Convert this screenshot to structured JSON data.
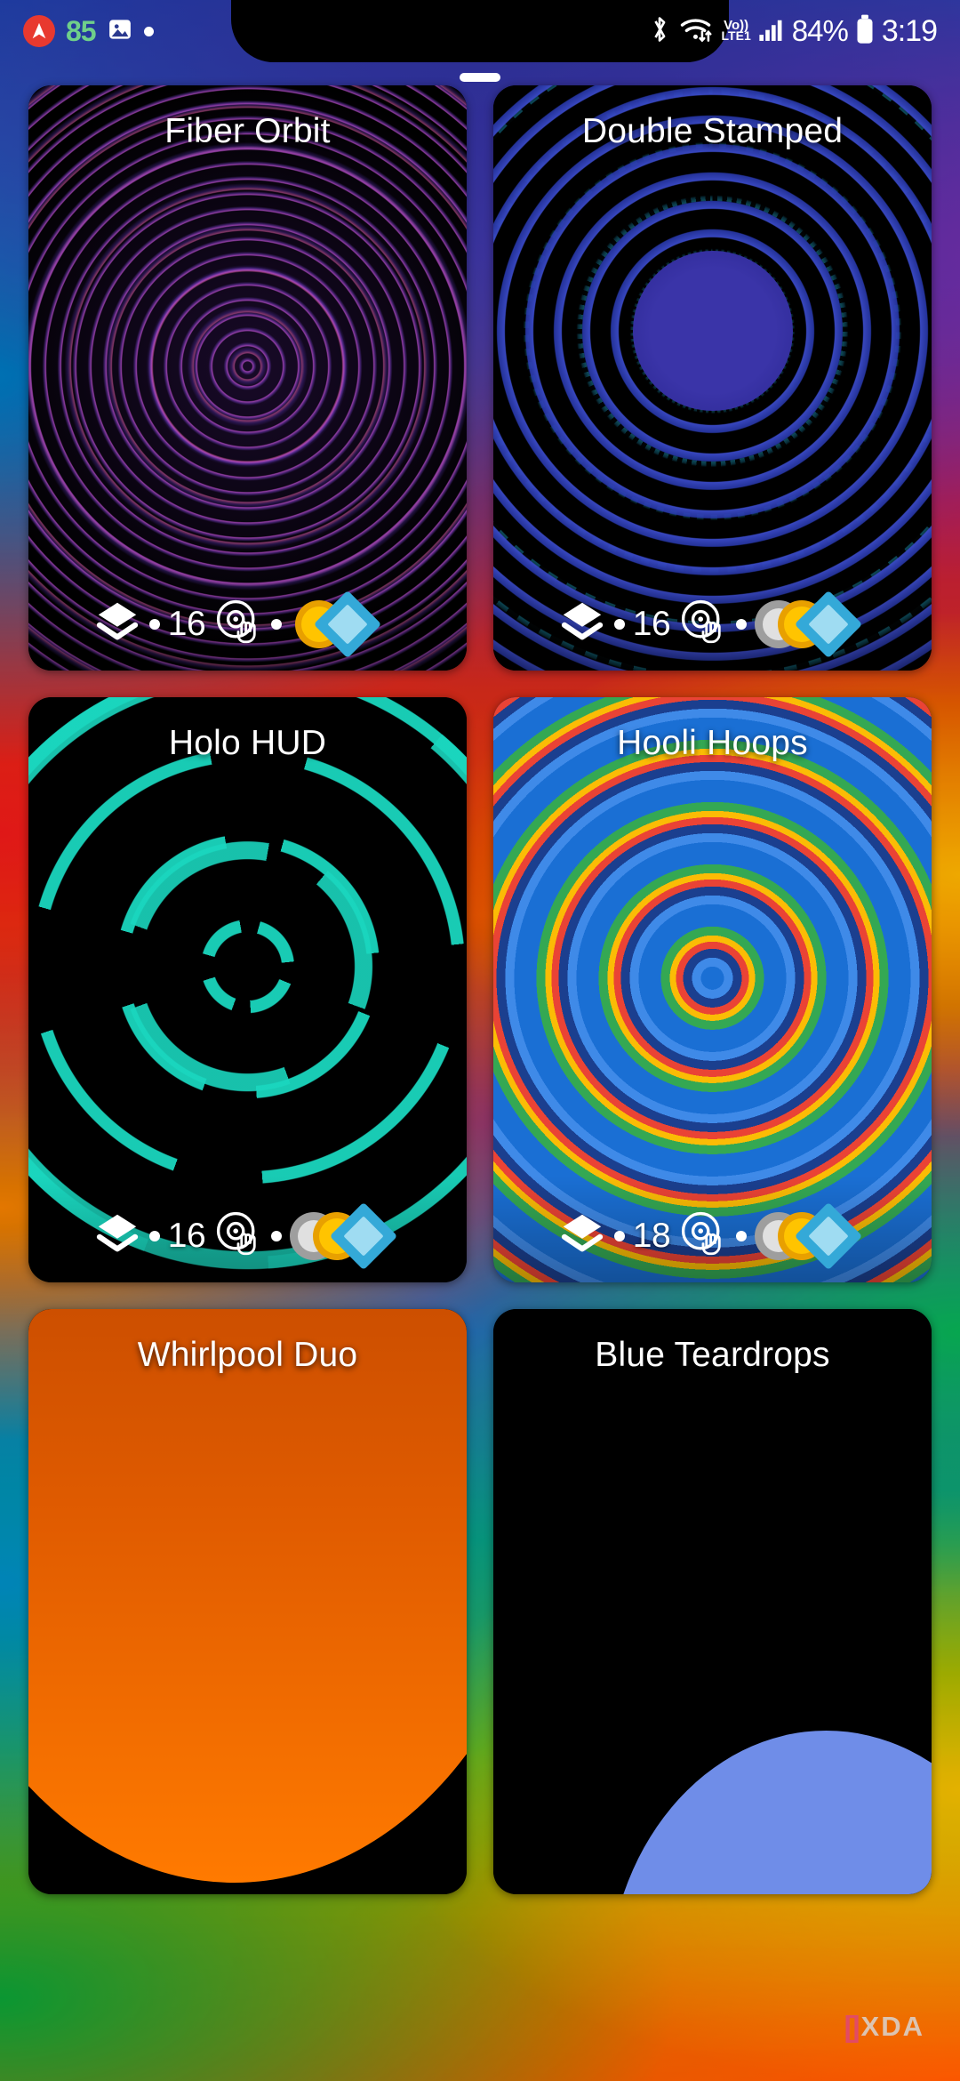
{
  "status_bar": {
    "left": {
      "nav_icon": "navigation-arrow-icon",
      "step_count": "85",
      "photo_icon": "image-icon",
      "extra_dot": "dot-indicator"
    },
    "right": {
      "bluetooth_icon": "bluetooth-icon",
      "wifi_icon": "wifi-data-transfer-icon",
      "volte_top": "Vo))",
      "volte_bottom": "LTE1",
      "signal_icon": "cellular-signal-icon",
      "battery_percent": "84%",
      "battery_icon": "battery-icon",
      "time": "3:19"
    }
  },
  "gesture_pill": "home-gesture-pill",
  "watermark": {
    "bracket": "[]",
    "text": "XDA"
  },
  "grid": {
    "cards": [
      {
        "title": "Fiber Orbit",
        "layers_icon": "layers-icon",
        "separator": "•",
        "count": "16",
        "disc_icon": "disc-tap-icon",
        "dot": "•",
        "shape_count": 2,
        "art": "art-fiber",
        "accent": "#b450d2"
      },
      {
        "title": "Double Stamped",
        "layers_icon": "layers-icon",
        "separator": "•",
        "count": "16",
        "disc_icon": "disc-tap-icon",
        "dot": "•",
        "shape_count": 3,
        "art": "art-stamp",
        "accent": "#3a34a8"
      },
      {
        "title": "Holo HUD",
        "layers_icon": "layers-icon",
        "separator": "•",
        "count": "16",
        "disc_icon": "disc-tap-icon",
        "dot": "•",
        "shape_count": 3,
        "art": "art-holo",
        "accent": "#1ad6be"
      },
      {
        "title": "Hooli Hoops",
        "layers_icon": "layers-icon",
        "separator": "•",
        "count": "18",
        "disc_icon": "disc-tap-icon",
        "dot": "•",
        "shape_count": 3,
        "art": "art-hooli",
        "accent": "#1a6fd4"
      },
      {
        "title": "Whirlpool Duo",
        "art": "art-whirl",
        "accent": "#ff7a00",
        "partial": true
      },
      {
        "title": "Blue Teardrops",
        "art": "art-blue",
        "accent": "#4a6fd8",
        "partial": true
      }
    ]
  },
  "shape_badge": {
    "gray_circle": "gray-circle-shape",
    "amber_circle": "amber-circle-shape",
    "cyan_diamond": "cyan-diamond-shape"
  }
}
